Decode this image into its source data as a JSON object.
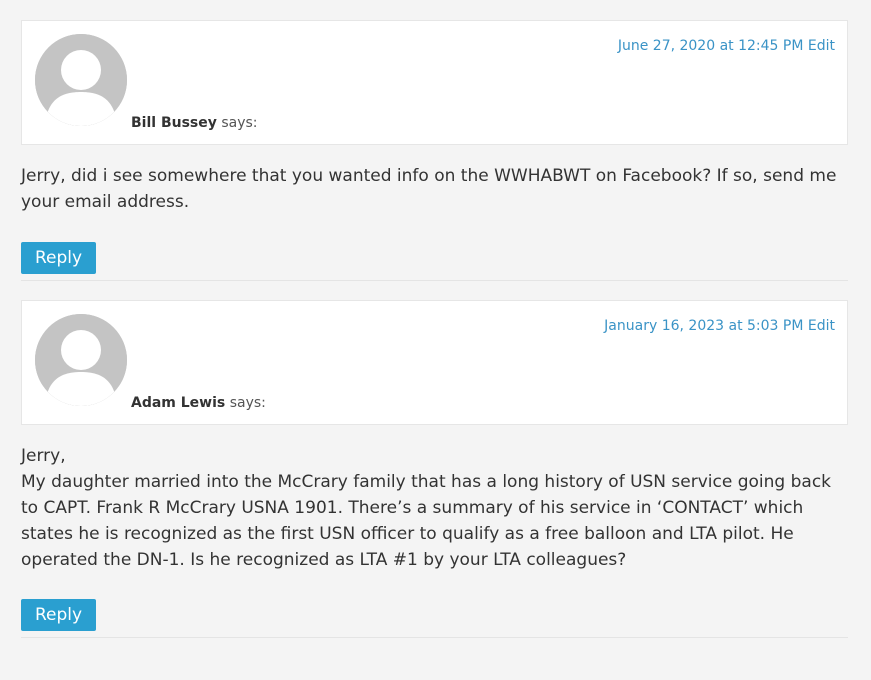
{
  "comments": [
    {
      "author": "Bill Bussey",
      "says": "says:",
      "date": "June 27, 2020 at 12:45 PM",
      "edit": "Edit",
      "body": [
        "Jerry, did i see somewhere that you wanted info on the WWHABWT on Facebook? If so, send me your email address."
      ],
      "reply": "Reply"
    },
    {
      "author": "Adam Lewis",
      "says": "says:",
      "date": "January 16, 2023 at 5:03 PM",
      "edit": "Edit",
      "body": [
        "Jerry,",
        "My daughter married into the McCrary family that has a long history of USN service going back to CAPT. Frank R McCrary USNA 1901. There’s a summary of his service in ‘CONTACT’ which states he is recognized as the first USN officer to qualify as a free balloon and LTA pilot. He operated the DN-1. Is he recognized as LTA #1 by your LTA colleagues?"
      ],
      "reply": "Reply"
    }
  ],
  "colors": {
    "background": "#f4f4f4",
    "link": "#3a93c6",
    "reply_button": "#2a9fd0",
    "avatar": "#c4c4c4"
  },
  "icons": {
    "avatar": "default-avatar-icon"
  }
}
